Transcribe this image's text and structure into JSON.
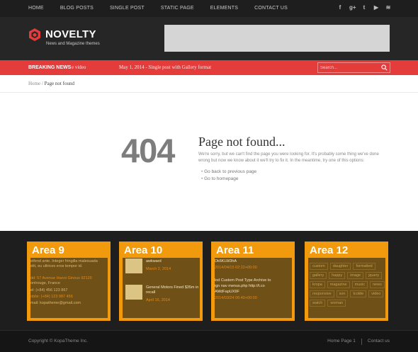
{
  "topnav": {
    "links": [
      "HOME",
      "BLOG POSTS",
      "SINGLE POST",
      "STATIC PAGE",
      "ELEMENTS",
      "CONTACT US"
    ],
    "social_icons": [
      "facebook-icon",
      "google-plus-icon",
      "twitter-icon",
      "youtube-icon",
      "rss-icon"
    ],
    "social_glyphs": [
      "f",
      "g+",
      "t",
      "▶",
      "≋"
    ]
  },
  "header": {
    "logo_title": "NOVELTY",
    "logo_tagline": "News and Magazine themes"
  },
  "breaking": {
    "label": "BREAKING NEWS",
    "item1": "e video",
    "item2": "May 1, 2014 - Single post with Gallery format",
    "search_placeholder": "Search..."
  },
  "breadcrumb": {
    "home": "Home",
    "sep": " / ",
    "current": "Page not found"
  },
  "notfound": {
    "code": "404",
    "title": "Page not found...",
    "text": "We're sorry, but we can't find the page you were looking for. It's probably some thing we've done wrong but now we know about it we'll try to fix it. In the meantime, try one of this options:",
    "links": [
      "Go back to previous page",
      "Go to homepage"
    ]
  },
  "areas": {
    "a9": {
      "title": "Area 9",
      "lines": [
        "eifend ante. Integer fringilla malesuada",
        "elit, eu ultrices eros tempor id.",
        "",
        "dd: 57 Avenue Hanoi Ginoux 92120",
        "ontrouge, France",
        "el: (+84) 456 123 867",
        "obile: (+84) 123 987 456",
        "mail: kopatheme@gmail.com"
      ]
    },
    "a10": {
      "title": "Area 10",
      "posts": [
        {
          "title": "awkward",
          "date": "March 2, 2014"
        },
        {
          "title": "General Motors Fined $35m in",
          "title2": "recall",
          "date": "April 16, 2014"
        }
      ]
    },
    "a11": {
      "title": "Area 11",
      "lines": [
        "Dk6KLW3hA",
        "2014/04/15 02:22+00:00",
        "",
        "lod Custom Post Type Archive to",
        "ign nav menus.php http://t.co",
        "AMdFapUX9F",
        "2014/03/24 06:40+00:00"
      ]
    },
    "a12": {
      "title": "Area 12",
      "tags": [
        "custom",
        "daughter",
        "formatted",
        "gallery",
        "happy",
        "image",
        "jquery",
        "kropa",
        "magazine",
        "music",
        "news",
        "responsive",
        "son",
        "tcolde",
        "video",
        "watch",
        "woman"
      ]
    }
  },
  "footer": {
    "copyright": "Copyright © KopaTheme Inc.",
    "link1": "Home Page 1",
    "link2": "Contact us"
  },
  "colors": {
    "accent_red": "#e43b3b",
    "area_orange": "#f29a0d",
    "dark_bg": "#1e1e1e"
  }
}
